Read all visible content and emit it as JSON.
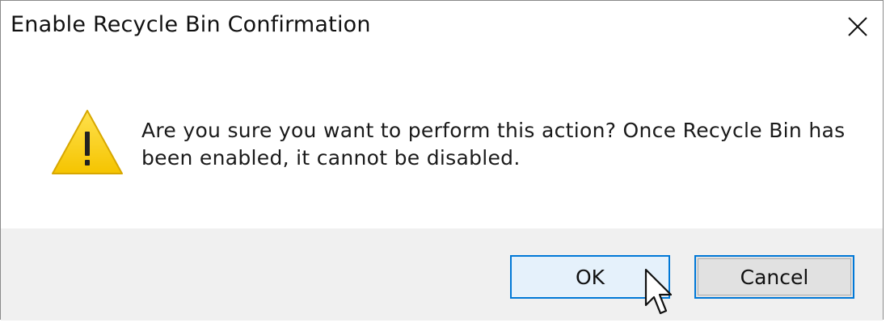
{
  "dialog": {
    "title": "Enable Recycle Bin Confirmation",
    "close_icon": "close-icon",
    "message": "Are you sure you want to perform this action? Once Recycle Bin has been enabled, it cannot be disabled.",
    "warning_icon": "warning-icon",
    "ok_label": "OK",
    "cancel_label": "Cancel"
  },
  "colors": {
    "accent": "#0078d7",
    "warning_fill": "#fcd116",
    "footer_bg": "#f0f0f0"
  }
}
